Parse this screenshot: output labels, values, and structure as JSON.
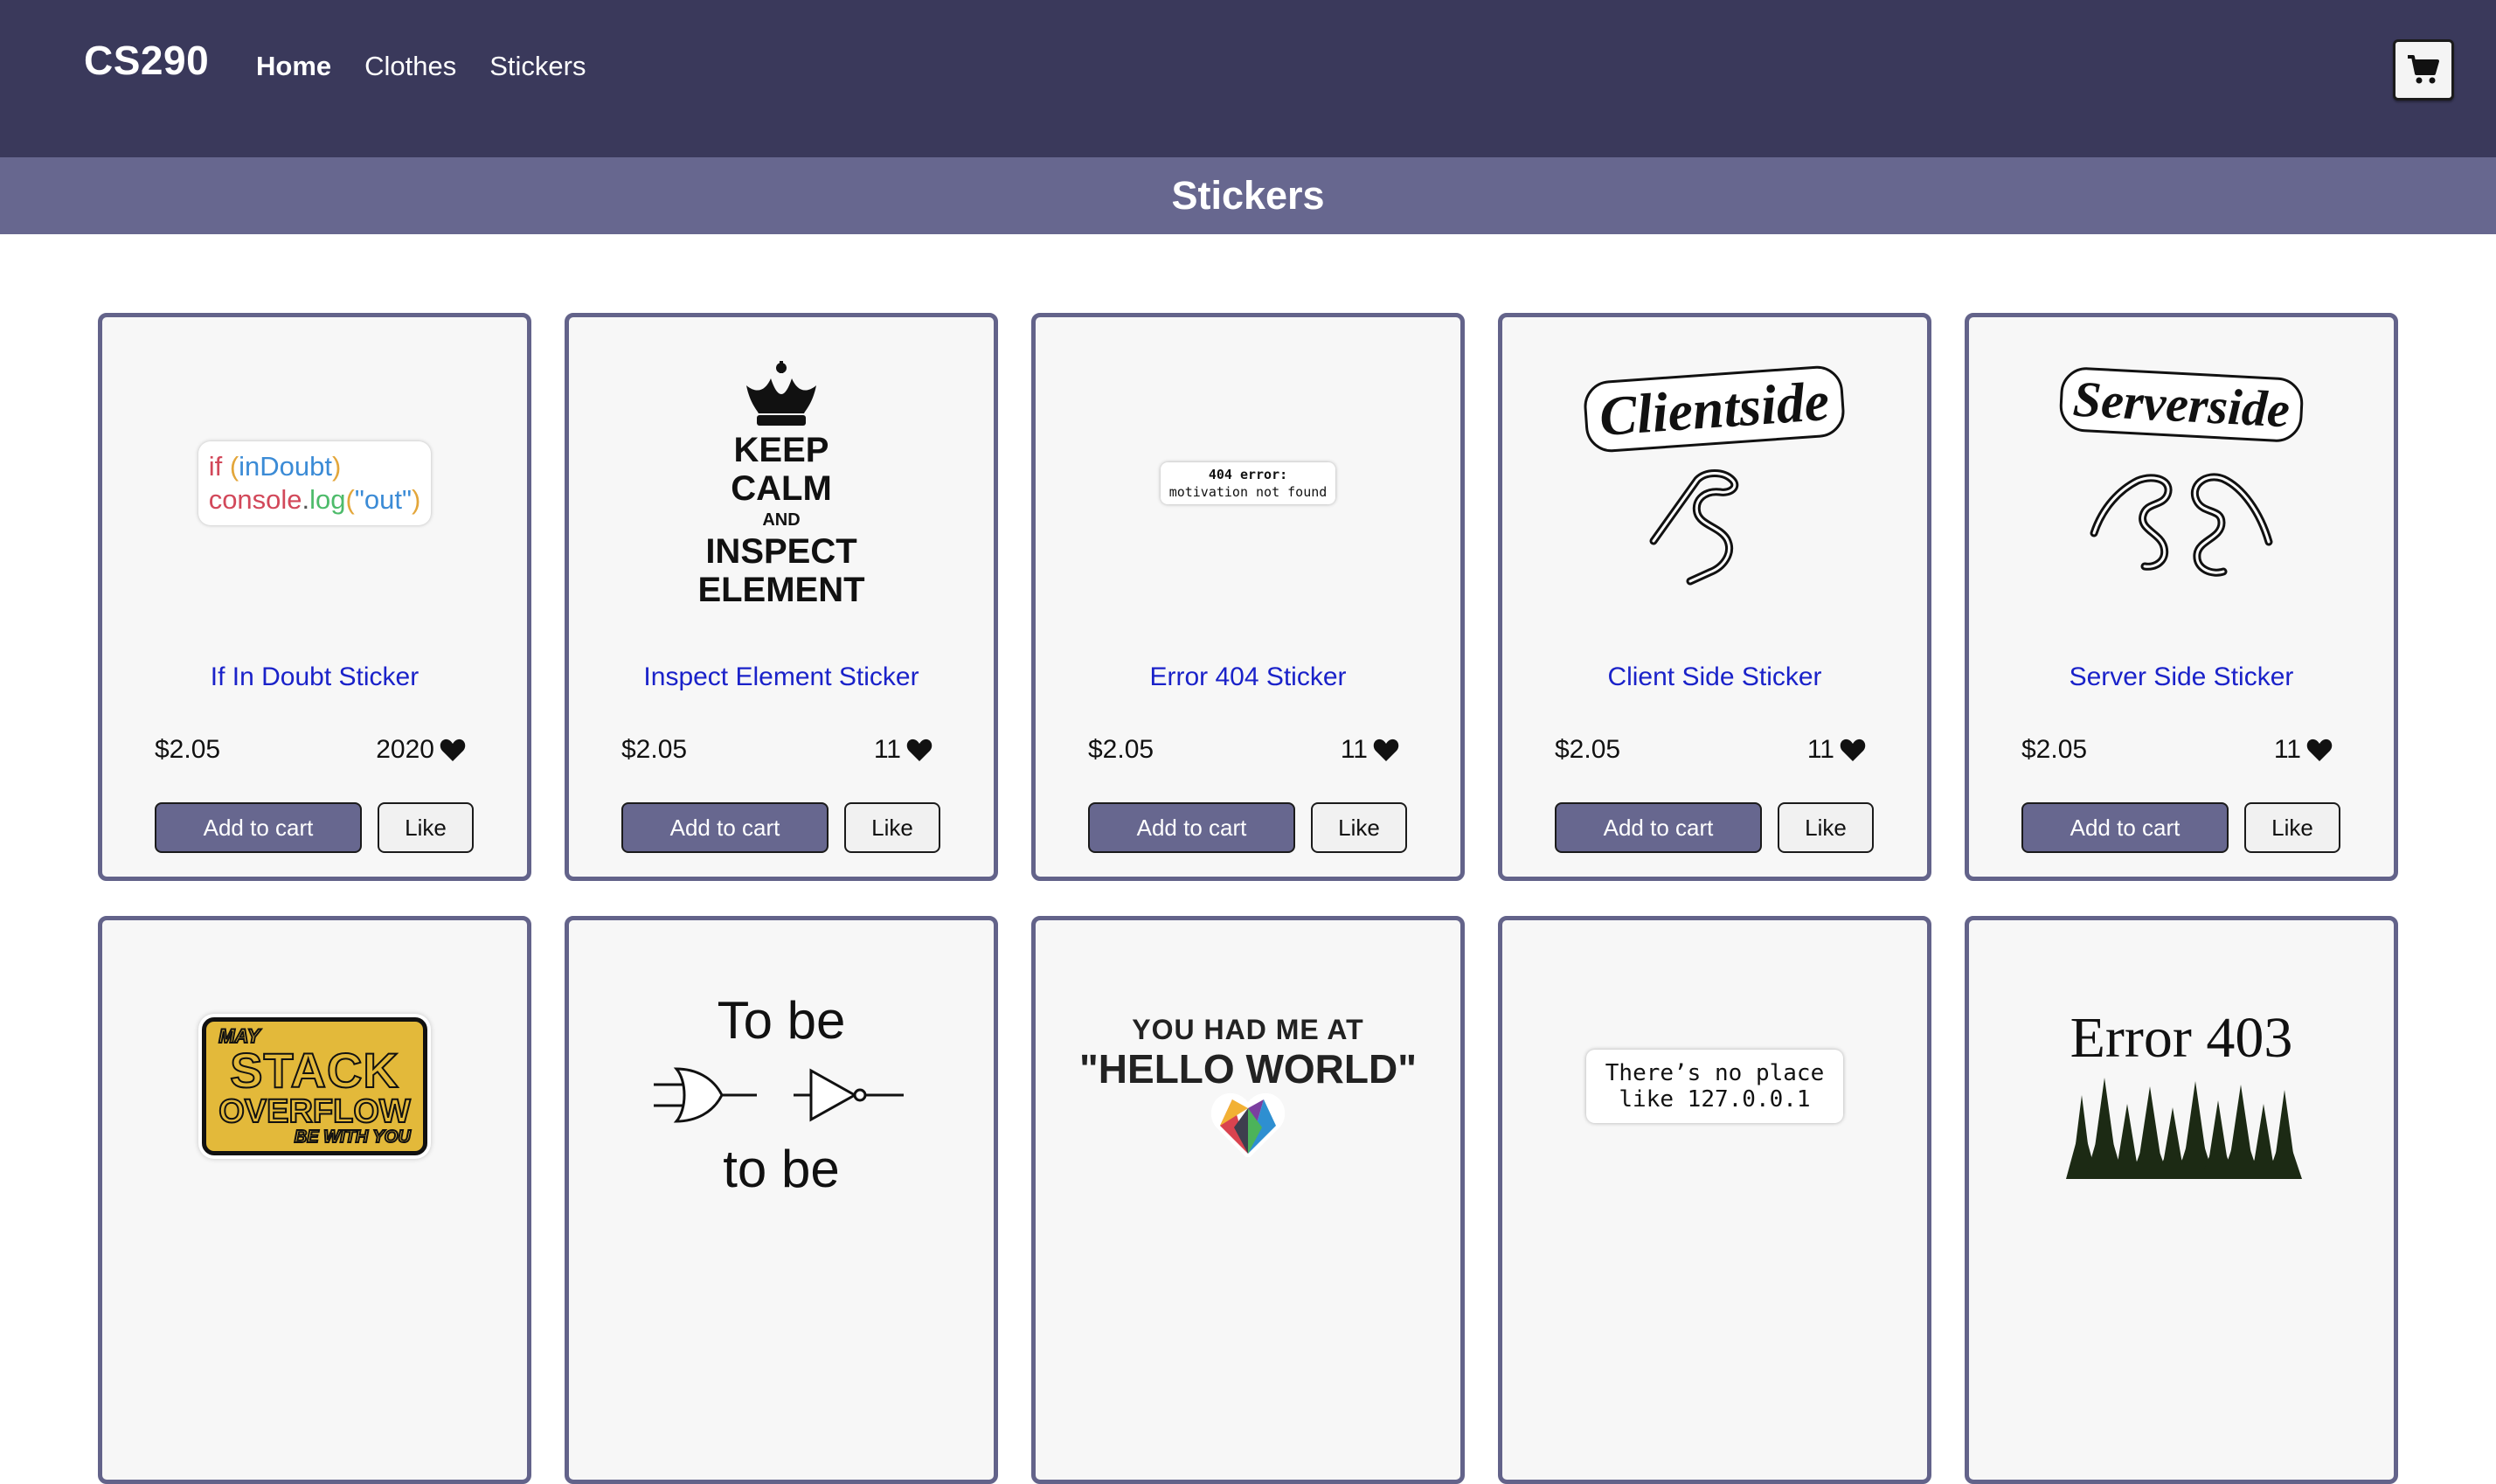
{
  "header": {
    "brand": "CS290",
    "nav": [
      {
        "label": "Home",
        "active": true
      },
      {
        "label": "Clothes",
        "active": false
      },
      {
        "label": "Stickers",
        "active": false
      }
    ],
    "cart_icon": "shopping-cart-icon"
  },
  "banner": {
    "title": "Stickers"
  },
  "buttons": {
    "add_to_cart": "Add to cart",
    "like": "Like"
  },
  "products": [
    {
      "title": "If In Doubt Sticker",
      "price": "$2.05",
      "likes": "2020",
      "sticker": {
        "line1_parts": [
          "if",
          "(",
          "inDoubt",
          ")"
        ],
        "line2_parts": [
          "console",
          ".",
          "log",
          "(",
          "\"out\"",
          ")"
        ]
      }
    },
    {
      "title": "Inspect Element Sticker",
      "price": "$2.05",
      "likes": "11",
      "sticker": {
        "lines": [
          "KEEP",
          "CALM",
          "AND",
          "INSPECT",
          "ELEMENT"
        ]
      }
    },
    {
      "title": "Error 404 Sticker",
      "price": "$2.05",
      "likes": "11",
      "sticker": {
        "lines": [
          "404 error:",
          "motivation not found"
        ]
      }
    },
    {
      "title": "Client Side Sticker",
      "price": "$2.05",
      "likes": "11",
      "sticker": {
        "word": "Clientside"
      }
    },
    {
      "title": "Server Side Sticker",
      "price": "$2.05",
      "likes": "11",
      "sticker": {
        "word": "Serverside"
      }
    },
    {
      "sticker": {
        "lines": [
          "MAY",
          "STACK",
          "OVERFLOW",
          "BE WITH YOU"
        ]
      }
    },
    {
      "sticker": {
        "lines": [
          "To be",
          "to be"
        ]
      }
    },
    {
      "sticker": {
        "lines": [
          "YOU HAD ME AT",
          "\"HELLO WORLD\""
        ]
      }
    },
    {
      "sticker": {
        "lines": [
          "There’s no place",
          "like 127.0.0.1"
        ]
      }
    },
    {
      "sticker": {
        "lines": [
          "Error 403"
        ]
      }
    }
  ],
  "colors": {
    "nav_bg": "#3a395b",
    "banner_bg": "#67678f",
    "link": "#1a22c9",
    "card_border": "#63638a"
  }
}
